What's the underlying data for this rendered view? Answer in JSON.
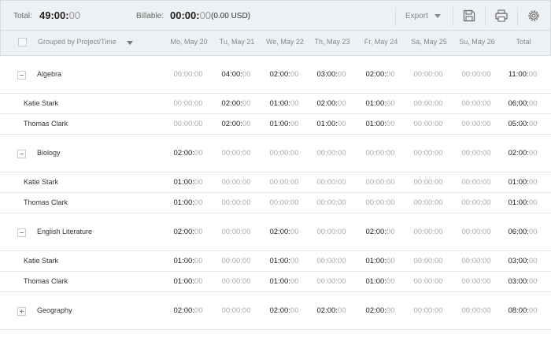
{
  "summary": {
    "total_label": "Total:",
    "total_strong": "49:00:",
    "total_light": "00",
    "billable_label": "Billable:",
    "billable_strong": "00:00:",
    "billable_light": "00",
    "billable_amount": "(0.00 USD)",
    "export_label": "Export"
  },
  "header": {
    "group_label": "Grouped by Project/Time",
    "columns": [
      "Mo, May 20",
      "Tu, May 21",
      "We, May 22",
      "Th, May 23",
      "Fr, May 24",
      "Sa, May 25",
      "Su, May 26",
      "Total"
    ]
  },
  "rows": [
    {
      "type": "project",
      "name": "Algebra",
      "expanded": true,
      "values": [
        "00:00:00",
        "04:00:00",
        "02:00:00",
        "03:00:00",
        "02:00:00",
        "00:00:00",
        "00:00:00",
        "11:00:00"
      ]
    },
    {
      "type": "member",
      "name": "Katie Stark",
      "values": [
        "00:00:00",
        "02:00:00",
        "01:00:00",
        "02:00:00",
        "01:00:00",
        "00:00:00",
        "00:00:00",
        "06:00:00"
      ]
    },
    {
      "type": "member",
      "name": "Thomas Clark",
      "values": [
        "00:00:00",
        "02:00:00",
        "01:00:00",
        "01:00:00",
        "01:00:00",
        "00:00:00",
        "00:00:00",
        "05:00:00"
      ]
    },
    {
      "type": "project",
      "name": "Biology",
      "expanded": true,
      "values": [
        "02:00:00",
        "00:00:00",
        "00:00:00",
        "00:00:00",
        "00:00:00",
        "00:00:00",
        "00:00:00",
        "02:00:00"
      ]
    },
    {
      "type": "member",
      "name": "Katie Stark",
      "values": [
        "01:00:00",
        "00:00:00",
        "00:00:00",
        "00:00:00",
        "00:00:00",
        "00:00:00",
        "00:00:00",
        "01:00:00"
      ]
    },
    {
      "type": "member",
      "name": "Thomas Clark",
      "values": [
        "01:00:00",
        "00:00:00",
        "00:00:00",
        "00:00:00",
        "00:00:00",
        "00:00:00",
        "00:00:00",
        "01:00:00"
      ]
    },
    {
      "type": "project",
      "name": "English Literature",
      "expanded": true,
      "values": [
        "02:00:00",
        "00:00:00",
        "02:00:00",
        "00:00:00",
        "02:00:00",
        "00:00:00",
        "00:00:00",
        "06:00:00"
      ]
    },
    {
      "type": "member",
      "name": "Katie Stark",
      "values": [
        "01:00:00",
        "00:00:00",
        "01:00:00",
        "00:00:00",
        "01:00:00",
        "00:00:00",
        "00:00:00",
        "03:00:00"
      ]
    },
    {
      "type": "member",
      "name": "Thomas Clark",
      "values": [
        "01:00:00",
        "00:00:00",
        "01:00:00",
        "00:00:00",
        "01:00:00",
        "00:00:00",
        "00:00:00",
        "03:00:00"
      ]
    },
    {
      "type": "project",
      "name": "Geography",
      "expanded": false,
      "values": [
        "02:00:00",
        "00:00:00",
        "02:00:00",
        "02:00:00",
        "02:00:00",
        "00:00:00",
        "00:00:00",
        "08:00:00"
      ]
    }
  ],
  "icons": {
    "save": "floppy-disk-icon",
    "print": "printer-icon",
    "settings": "gear-icon",
    "collapse": "minus-square-icon",
    "expand": "plus-square-icon"
  }
}
